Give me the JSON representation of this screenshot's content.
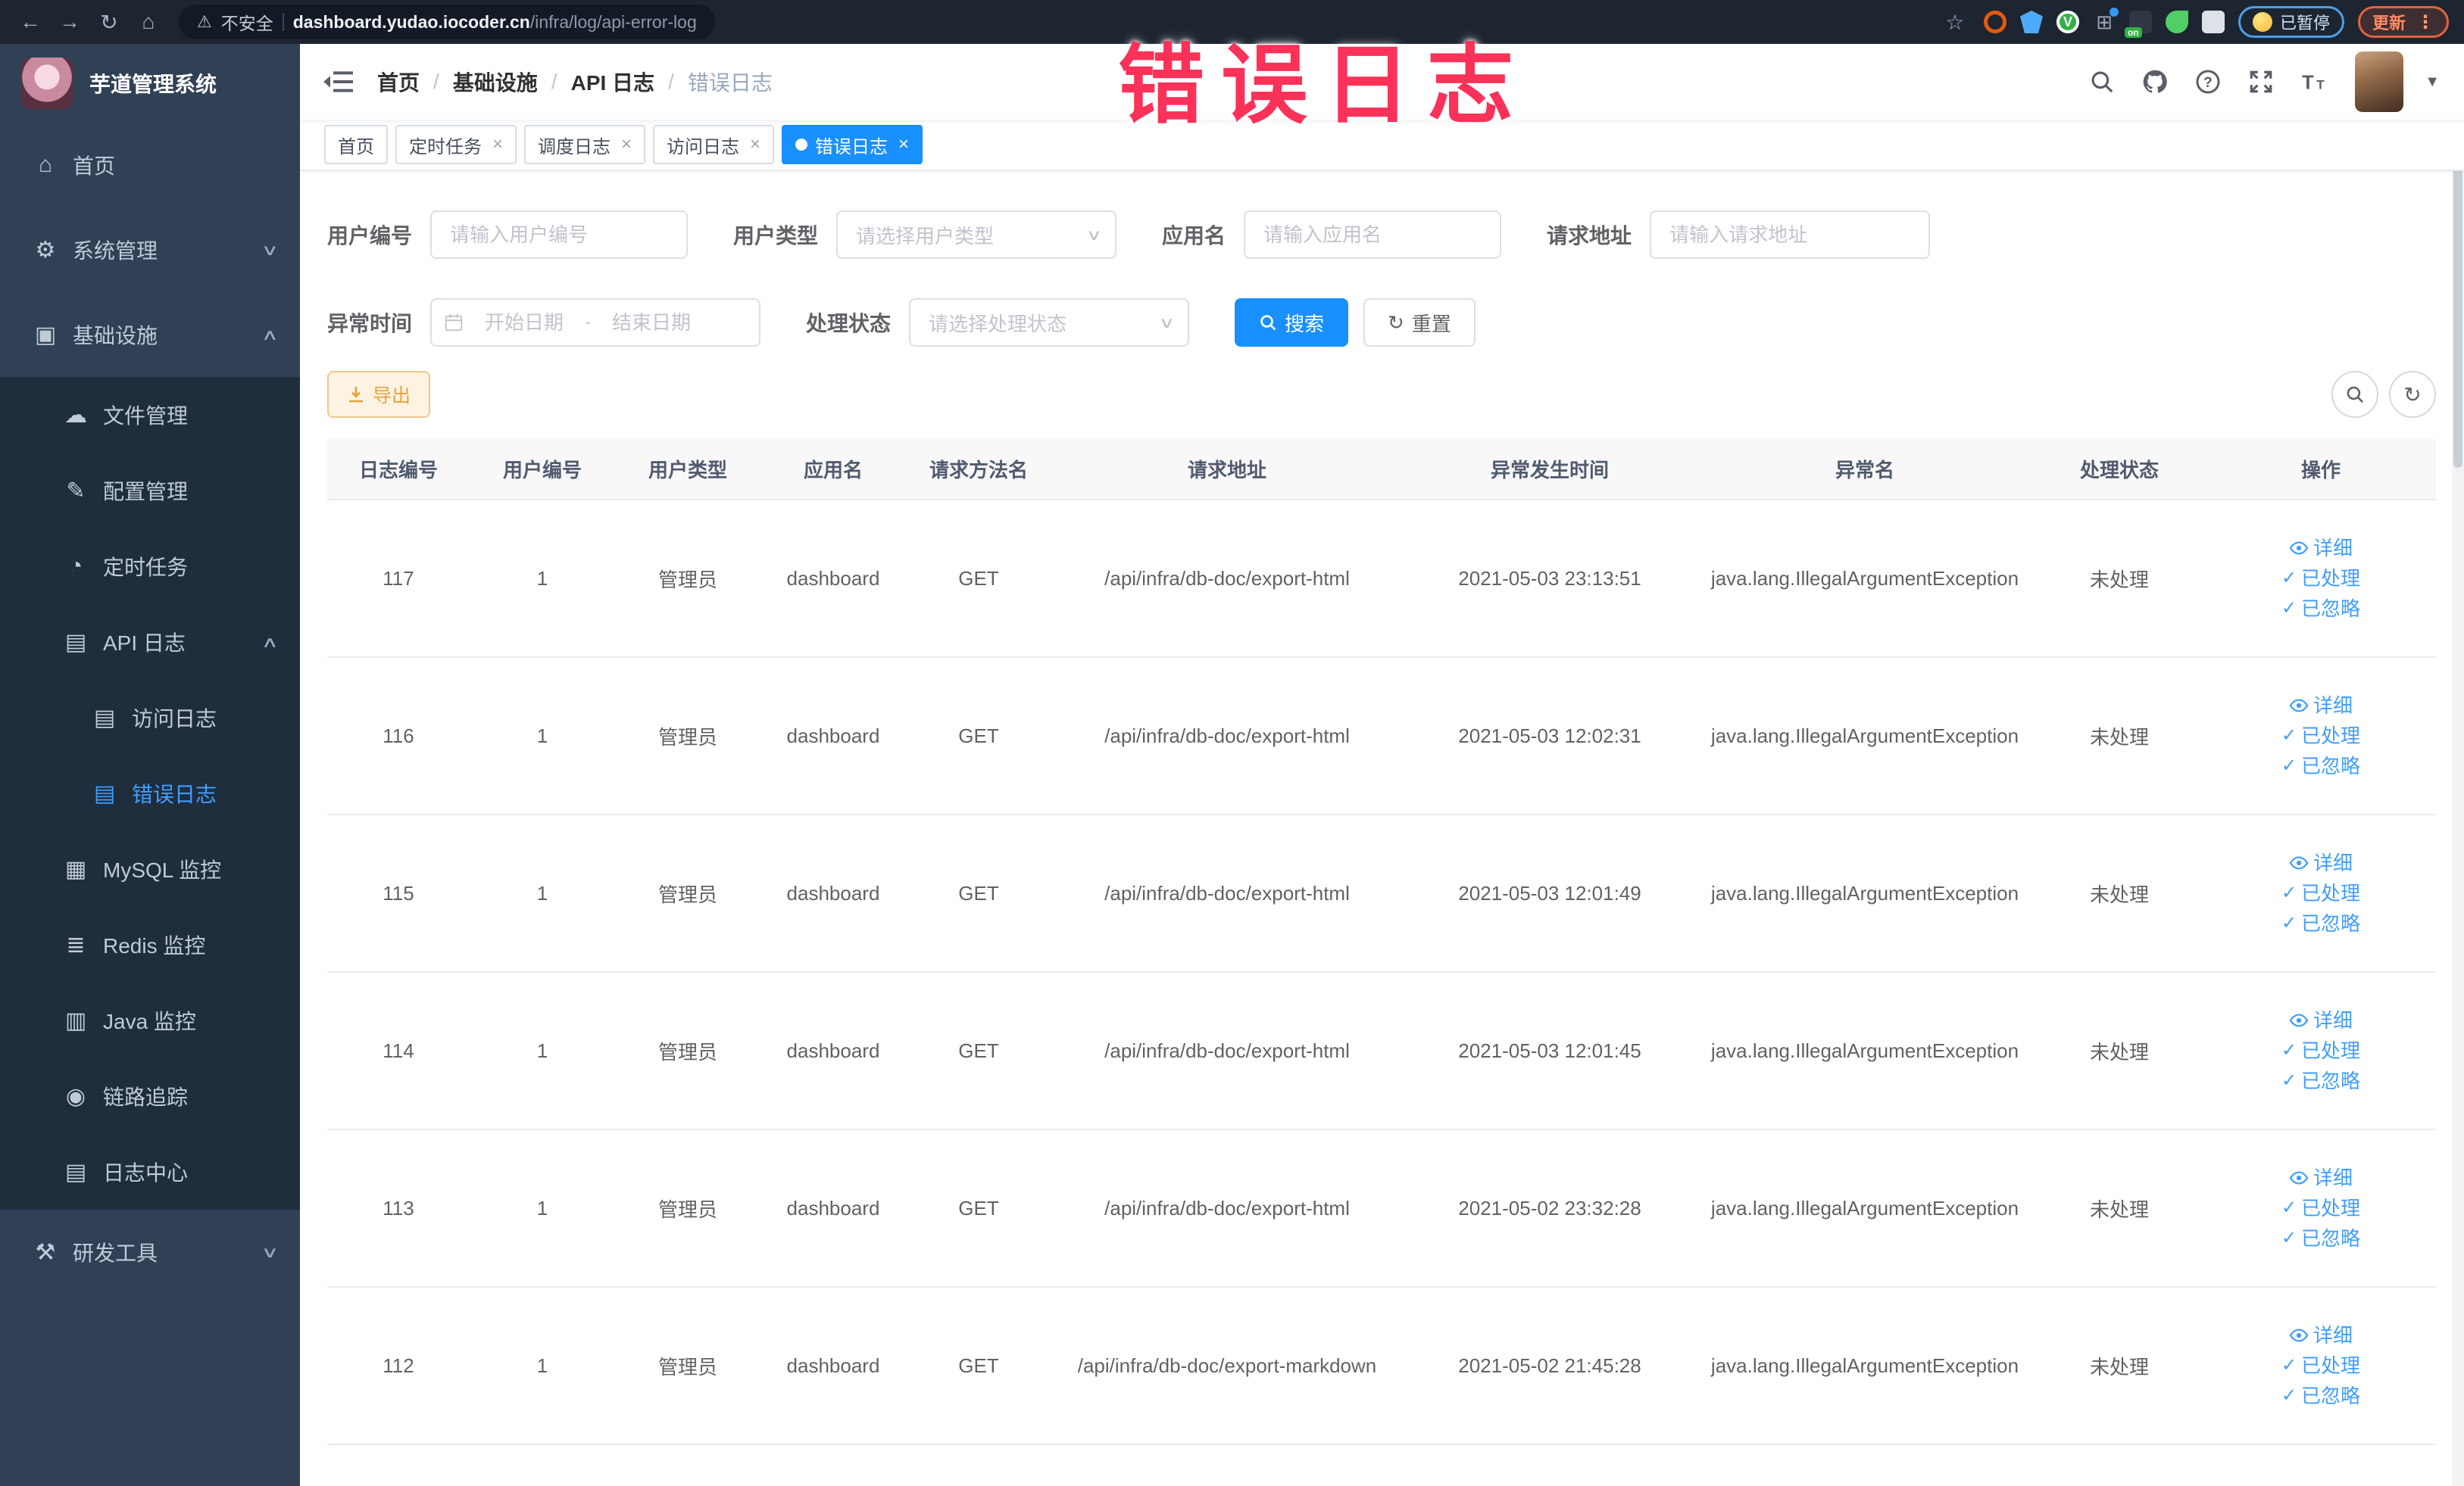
{
  "browser": {
    "security_label": "不安全",
    "url_host": "dashboard.yudao.iocoder.cn",
    "url_path": "/infra/log/api-error-log",
    "paused_badge": "已暂停",
    "update_badge": "更新"
  },
  "annotation": {
    "text": "错误日志",
    "color": "#fa3158"
  },
  "colors": {
    "accent": "#1890ff",
    "sidebar": "#304156",
    "submenu": "#1f2d3d",
    "active_menu": "#409eff",
    "warning": "#e6a23c"
  },
  "icons": {
    "home-icon": "⌂",
    "gear-icon": "⚙",
    "infra-icon": "▣",
    "file-icon": "☁",
    "config-icon": "✎",
    "timer-icon": "◔",
    "api-log-icon": "▤",
    "access-log-icon": "▤",
    "error-log-icon": "▤",
    "mysql-icon": "▦",
    "redis-icon": "≣",
    "java-icon": "▥",
    "trace-icon": "◉",
    "log-center-icon": "▤",
    "devtools-icon": "⚒",
    "chevron-up": "∧",
    "chevron-down": "∨"
  },
  "sidebar": {
    "title": "芋道管理系统",
    "items": [
      {
        "label": "首页",
        "icon": "home-icon",
        "level": 0
      },
      {
        "label": "系统管理",
        "icon": "gear-icon",
        "level": 0,
        "chevron": "down"
      },
      {
        "label": "基础设施",
        "icon": "infra-icon",
        "level": 0,
        "chevron": "up"
      },
      {
        "label": "文件管理",
        "icon": "file-icon",
        "level": 1
      },
      {
        "label": "配置管理",
        "icon": "config-icon",
        "level": 1
      },
      {
        "label": "定时任务",
        "icon": "timer-icon",
        "level": 1
      },
      {
        "label": "API 日志",
        "icon": "api-log-icon",
        "level": 1,
        "chevron": "up"
      },
      {
        "label": "访问日志",
        "icon": "access-log-icon",
        "level": 2
      },
      {
        "label": "错误日志",
        "icon": "error-log-icon",
        "level": 2,
        "active": true
      },
      {
        "label": "MySQL 监控",
        "icon": "mysql-icon",
        "level": 1
      },
      {
        "label": "Redis 监控",
        "icon": "redis-icon",
        "level": 1
      },
      {
        "label": "Java 监控",
        "icon": "java-icon",
        "level": 1
      },
      {
        "label": "链路追踪",
        "icon": "trace-icon",
        "level": 1
      },
      {
        "label": "日志中心",
        "icon": "log-center-icon",
        "level": 1
      },
      {
        "label": "研发工具",
        "icon": "devtools-icon",
        "level": 0,
        "chevron": "down"
      }
    ]
  },
  "navbar": {
    "breadcrumb": [
      "首页",
      "基础设施",
      "API 日志",
      "错误日志"
    ]
  },
  "tags": [
    {
      "label": "首页",
      "closable": false,
      "active": false
    },
    {
      "label": "定时任务",
      "closable": true,
      "active": false
    },
    {
      "label": "调度日志",
      "closable": true,
      "active": false
    },
    {
      "label": "访问日志",
      "closable": true,
      "active": false
    },
    {
      "label": "错误日志",
      "closable": true,
      "active": true
    }
  ],
  "filters": {
    "user_id": {
      "label": "用户编号",
      "placeholder": "请输入用户编号"
    },
    "user_type": {
      "label": "用户类型",
      "placeholder": "请选择用户类型"
    },
    "app_name": {
      "label": "应用名",
      "placeholder": "请输入应用名"
    },
    "request_url": {
      "label": "请求地址",
      "placeholder": "请输入请求地址"
    },
    "exception_time": {
      "label": "异常时间",
      "start_placeholder": "开始日期",
      "separator": "-",
      "end_placeholder": "结束日期"
    },
    "process_status": {
      "label": "处理状态",
      "placeholder": "请选择处理状态"
    },
    "search_label": "搜索",
    "reset_label": "重置"
  },
  "toolbar": {
    "export_label": "导出"
  },
  "table": {
    "columns": [
      "日志编号",
      "用户编号",
      "用户类型",
      "应用名",
      "请求方法名",
      "请求地址",
      "异常发生时间",
      "异常名",
      "处理状态",
      "操作"
    ],
    "actions": {
      "detail": "详细",
      "processed": "已处理",
      "ignored": "已忽略"
    },
    "rows": [
      {
        "id": "117",
        "user_id": "1",
        "user_type": "管理员",
        "app": "dashboard",
        "method": "GET",
        "url": "/api/infra/db-doc/export-html",
        "time": "2021-05-03 23:13:51",
        "exception": "java.lang.IllegalArgumentException",
        "status": "未处理"
      },
      {
        "id": "116",
        "user_id": "1",
        "user_type": "管理员",
        "app": "dashboard",
        "method": "GET",
        "url": "/api/infra/db-doc/export-html",
        "time": "2021-05-03 12:02:31",
        "exception": "java.lang.IllegalArgumentException",
        "status": "未处理"
      },
      {
        "id": "115",
        "user_id": "1",
        "user_type": "管理员",
        "app": "dashboard",
        "method": "GET",
        "url": "/api/infra/db-doc/export-html",
        "time": "2021-05-03 12:01:49",
        "exception": "java.lang.IllegalArgumentException",
        "status": "未处理"
      },
      {
        "id": "114",
        "user_id": "1",
        "user_type": "管理员",
        "app": "dashboard",
        "method": "GET",
        "url": "/api/infra/db-doc/export-html",
        "time": "2021-05-03 12:01:45",
        "exception": "java.lang.IllegalArgumentException",
        "status": "未处理"
      },
      {
        "id": "113",
        "user_id": "1",
        "user_type": "管理员",
        "app": "dashboard",
        "method": "GET",
        "url": "/api/infra/db-doc/export-html",
        "time": "2021-05-02 23:32:28",
        "exception": "java.lang.IllegalArgumentException",
        "status": "未处理"
      },
      {
        "id": "112",
        "user_id": "1",
        "user_type": "管理员",
        "app": "dashboard",
        "method": "GET",
        "url": "/api/infra/db-doc/export-markdown",
        "time": "2021-05-02 21:45:28",
        "exception": "java.lang.IllegalArgumentException",
        "status": "未处理"
      }
    ]
  }
}
